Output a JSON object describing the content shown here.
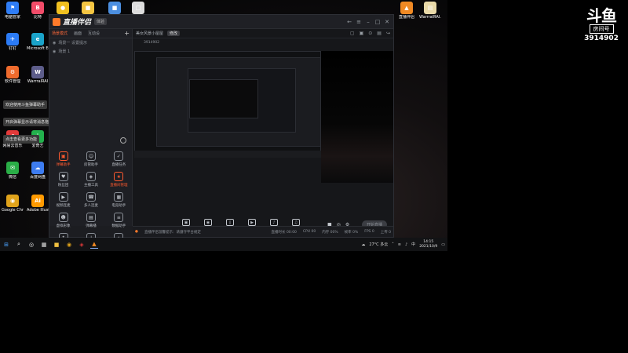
{
  "desktop": {
    "icons": [
      {
        "label": "电脑管家",
        "color": "#2f7df6",
        "glyph": "⚑"
      },
      {
        "label": "比特",
        "color": "#f24c69",
        "glyph": "B"
      },
      {
        "label": "",
        "color": "#f0c020",
        "glyph": "●"
      },
      {
        "label": "",
        "color": "#f4c542",
        "glyph": "■"
      },
      {
        "label": "",
        "color": "#4c8fe0",
        "glyph": "■"
      },
      {
        "label": "",
        "color": "#dcdcdc",
        "glyph": "□"
      },
      {
        "label": "钉钉",
        "color": "#2b7bf6",
        "glyph": "✈"
      },
      {
        "label": "Microsoft Edge",
        "color": "#1aa3c9",
        "glyph": "e"
      },
      {
        "label": "软件管理",
        "color": "#ef6b2d",
        "glyph": "⚙"
      },
      {
        "label": "WarrralRAI",
        "color": "#5d5d8a",
        "glyph": "W"
      },
      {
        "label": "网易云音乐",
        "color": "#e23a3a",
        "glyph": "♫"
      },
      {
        "label": "爱奇艺",
        "color": "#23b14d",
        "glyph": "i"
      },
      {
        "label": "微信",
        "color": "#2aae47",
        "glyph": "✉"
      },
      {
        "label": "百度网盘",
        "color": "#3d7cf0",
        "glyph": "☁"
      },
      {
        "label": "Google Chrome",
        "color": "#e0a31b",
        "glyph": "◉"
      },
      {
        "label": "Adobe Illustrat...",
        "color": "#ff9a00",
        "glyph": "Ai"
      },
      {
        "label": "直播伴侣",
        "color": "#f08a24",
        "glyph": "▲"
      },
      {
        "label": "WarrralRAI...",
        "color": "#e8d9a8",
        "glyph": "▤"
      }
    ],
    "notices": [
      "欢迎使用斗鱼弹幕助手",
      "开启弹幕显示请将消息拖动到此处",
      "点击查看更多功能"
    ]
  },
  "app": {
    "title": "直播伴侣",
    "version_badge": "体验",
    "window_controls": [
      "←",
      "≡",
      "–",
      "□",
      "✕"
    ],
    "scene_tabs": [
      "场景模式",
      "画面",
      "互动设",
      "+"
    ],
    "scene_rows": [
      "场景一 设置提示",
      "场景 1"
    ],
    "tools": [
      {
        "label": "弹幕助手",
        "glyph": "▣",
        "hot": true
      },
      {
        "label": "房管助手",
        "glyph": "☺",
        "hot": false
      },
      {
        "label": "直播任务",
        "glyph": "✓",
        "hot": false
      },
      {
        "label": "粉丝团",
        "glyph": "♥",
        "hot": false
      },
      {
        "label": "主播工具",
        "glyph": "◈",
        "hot": false
      },
      {
        "label": "直播间管理",
        "glyph": "★",
        "hot": true
      },
      {
        "label": "视频连麦",
        "glyph": "▶",
        "hot": false
      },
      {
        "label": "多人连麦",
        "glyph": "☎",
        "hot": false
      },
      {
        "label": "电竞助手",
        "glyph": "▦",
        "hot": false
      },
      {
        "label": "虚拟形象",
        "glyph": "☻",
        "hot": false
      },
      {
        "label": "弹幕播",
        "glyph": "▤",
        "hot": false
      },
      {
        "label": "数据助手",
        "glyph": "≡",
        "hot": false
      },
      {
        "label": "",
        "glyph": "↑",
        "hot": false
      },
      {
        "label": "",
        "glyph": "↓",
        "hot": false
      },
      {
        "label": "",
        "glyph": "△",
        "hot": false
      }
    ],
    "stream": {
      "title": "美女风景小屋屋",
      "tag": "修改",
      "sub_category": "",
      "room_label": "",
      "room_id": "3914902",
      "head_icons": [
        "▢",
        "▣",
        "⊙",
        "▤",
        "↪"
      ]
    },
    "controls": [
      {
        "label": "直播画面",
        "glyph": "▣"
      },
      {
        "label": "摄像头",
        "glyph": "◉"
      },
      {
        "label": "手机投屏",
        "glyph": "▯"
      },
      {
        "label": "多媒体",
        "glyph": "▶"
      },
      {
        "label": "麦克风",
        "glyph": "♪"
      },
      {
        "label": "扬声器",
        "glyph": "♫"
      }
    ],
    "mini_controls": [
      "■",
      "◎",
      "⚙"
    ],
    "start_button": "开始直播",
    "status_warning": "直播伴侣温馨提示：请遵守平台规定",
    "status_stats": [
      "直播时长 00:00",
      "CPU 00",
      "内存 00%",
      "帧率 0%",
      "FPS 0",
      "上传 0"
    ]
  },
  "taskbar": {
    "apps": [
      "⊞",
      "⌕",
      "◎",
      "▦",
      "■",
      "◉",
      "◈",
      "▲"
    ],
    "weather": "27°C 多云",
    "time": "14:15",
    "date": "2021/10/9"
  },
  "overlay": {
    "logo": "斗鱼",
    "tag": "房间号",
    "room_id": "3914902"
  },
  "colors": {
    "accent": "#ff6a3a",
    "app_bg": "#1c1d21"
  }
}
